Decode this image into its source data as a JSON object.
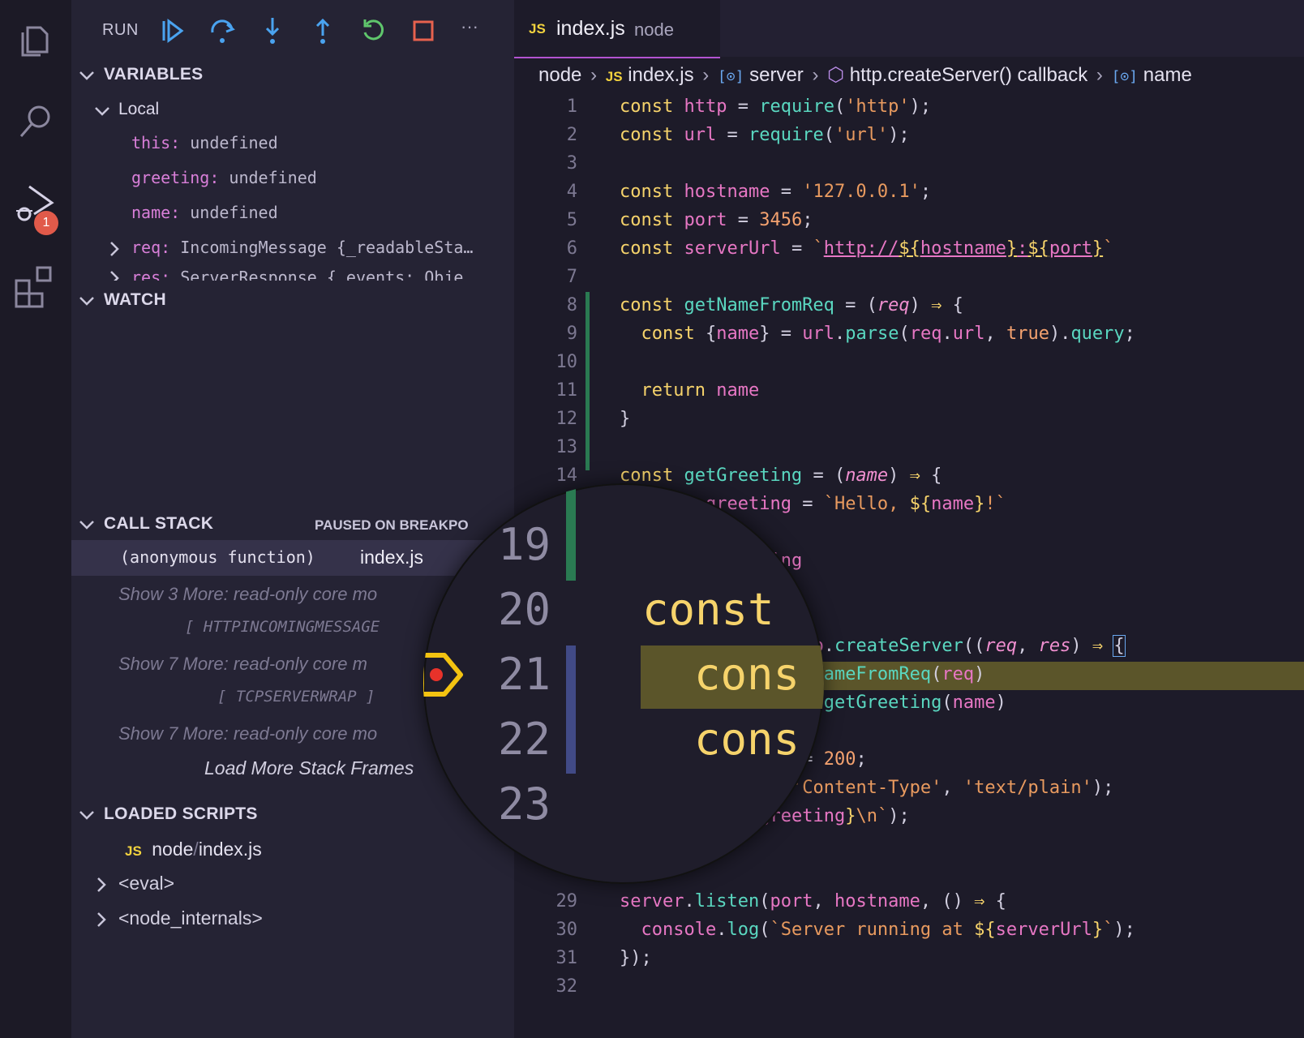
{
  "activity_bar": {
    "debug_badge": "1"
  },
  "toolbar": {
    "run_label": "RUN",
    "more_label": "···"
  },
  "variables": {
    "title": "VARIABLES",
    "local_label": "Local",
    "items": [
      {
        "name": "this:",
        "value": " undefined"
      },
      {
        "name": "greeting:",
        "value": " undefined"
      },
      {
        "name": "name:",
        "value": " undefined"
      },
      {
        "name": "req:",
        "value": " IncomingMessage {_readableSta…"
      },
      {
        "name": "res:",
        "value": " ServerResponse {_events: Obje"
      }
    ]
  },
  "watch": {
    "title": "WATCH"
  },
  "call_stack": {
    "title": "CALL STACK",
    "status": "PAUSED ON BREAKPO",
    "frame_name": "(anonymous function)",
    "frame_file": "index.js",
    "more1": "Show 3 More: read-only core mo",
    "group1": "[ HTTPINCOMINGMESSAGE",
    "more2": "Show 7 More: read-only core m",
    "group2": "[ TCPSERVERWRAP ]",
    "more3": "Show 7 More: read-only core mo",
    "load_more": "Load More Stack Frames"
  },
  "loaded_scripts": {
    "title": "LOADED SCRIPTS",
    "script_badge": "JS",
    "script_folder": "node",
    "script_sep": "/",
    "script_file": "index.js",
    "eval": "<eval>",
    "internals": "<node_internals>"
  },
  "editor": {
    "tab_badge": "JS",
    "tab_name": "index.js",
    "tab_desc": "node",
    "breadcrumb": {
      "node": "node",
      "js_badge": "JS",
      "file": "index.js",
      "server": "server",
      "callback": "http.createServer() callback",
      "name": "name"
    }
  },
  "lens": {
    "line_numbers": [
      "19",
      "20",
      "21",
      "22",
      "23"
    ],
    "code_20": "const",
    "code_21": "cons",
    "code_22": "cons"
  },
  "colors": {
    "accent": "#b353d1",
    "keyword": "#f6d36b",
    "identifier": "#e777c4",
    "function": "#5ad7c0",
    "string": "#e89a5f",
    "breakpoint": "#f3c311",
    "badge": "#e15a4a"
  }
}
